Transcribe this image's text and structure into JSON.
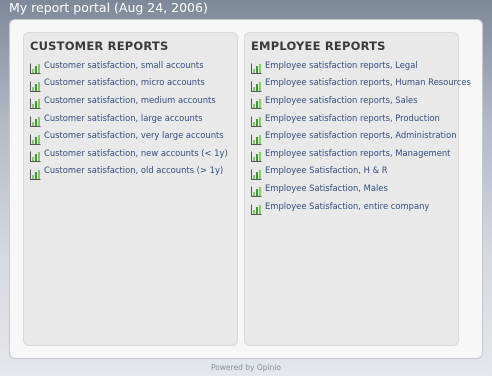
{
  "header": {
    "title": "My report portal (Aug 24, 2006)"
  },
  "columns": {
    "customer": {
      "title": "CUSTOMER REPORTS",
      "items": [
        "Customer satisfaction, small accounts",
        "Customer satisfaction, micro accounts",
        "Customer satisfaction, medium accounts",
        "Customer satisfaction, large accounts",
        "Customer satisfaction, very large accounts",
        "Customer satisfaction, new accounts (< 1y)",
        "Customer satisfaction, old accounts (> 1y)"
      ]
    },
    "employee": {
      "title": "EMPLOYEE REPORTS",
      "items": [
        "Employee satisfaction reports, Legal",
        "Employee satisfaction reports, Human Resources",
        "Employee satisfaction reports, Sales",
        "Employee satisfaction reports, Production",
        "Employee satisfaction reports, Administration",
        "Employee satisfaction reports, Management",
        "Employee Satisfaction, H & R",
        "Employee Satisfaction, Males",
        "Employee Satisfaction, entire company"
      ]
    }
  },
  "footer": {
    "text": "Powered by Opinio"
  },
  "icon": {
    "name": "bar-chart-icon",
    "colors": {
      "bar": "#3f9a2e",
      "bar_light": "#86c96a",
      "axis": "#555555"
    }
  },
  "colors": {
    "link": "#2f4d82",
    "heading": "#3a3a3a"
  }
}
